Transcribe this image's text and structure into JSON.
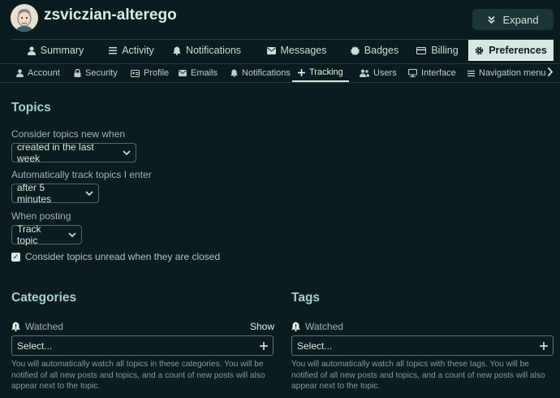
{
  "header": {
    "username": "zsviczian-alterego",
    "expand_label": "Expand"
  },
  "main_nav": {
    "items": [
      {
        "label": "Summary",
        "icon": "user-icon"
      },
      {
        "label": "Activity",
        "icon": "list-icon"
      },
      {
        "label": "Notifications",
        "icon": "bell-icon"
      },
      {
        "label": "Messages",
        "icon": "envelope-icon"
      },
      {
        "label": "Badges",
        "icon": "badge-icon"
      },
      {
        "label": "Billing",
        "icon": "credit-card-icon"
      },
      {
        "label": "Preferences",
        "icon": "gear-icon",
        "active": true
      }
    ]
  },
  "sub_nav": {
    "items": [
      {
        "label": "Account",
        "icon": "user-icon"
      },
      {
        "label": "Security",
        "icon": "lock-icon"
      },
      {
        "label": "Profile",
        "icon": "id-card-icon"
      },
      {
        "label": "Emails",
        "icon": "envelope-icon"
      },
      {
        "label": "Notifications",
        "icon": "bell-icon"
      },
      {
        "label": "Tracking",
        "icon": "plus-icon",
        "active": true
      },
      {
        "label": "Users",
        "icon": "users-icon"
      },
      {
        "label": "Interface",
        "icon": "desktop-icon"
      },
      {
        "label": "Navigation menu",
        "icon": "bars-icon"
      }
    ]
  },
  "topics": {
    "heading": "Topics",
    "new_when_label": "Consider topics new when",
    "new_when_value": "created in the last week",
    "auto_track_label": "Automatically track topics I enter",
    "auto_track_value": "after 5 minutes",
    "when_posting_label": "When posting",
    "when_posting_value": "Track topic",
    "unread_closed_label": "Consider topics unread when they are closed",
    "unread_closed_checked": true
  },
  "categories": {
    "heading": "Categories",
    "watched_label": "Watched",
    "show_label": "Show",
    "select_placeholder": "Select...",
    "description": "You will automatically watch all topics in these categories. You will be notified of all new posts and topics, and a count of new posts will also appear next to the topic."
  },
  "tags": {
    "heading": "Tags",
    "watched_label": "Watched",
    "select_placeholder": "Select...",
    "description": "You will automatically watch all topics with these tags. You will be notified of all new posts and topics, and a count of new posts will also appear next to the topic."
  },
  "colors": {
    "background": "#0a1c1d",
    "heading": "#a9cfcb",
    "active_tab_bg": "#d9e6e3"
  }
}
